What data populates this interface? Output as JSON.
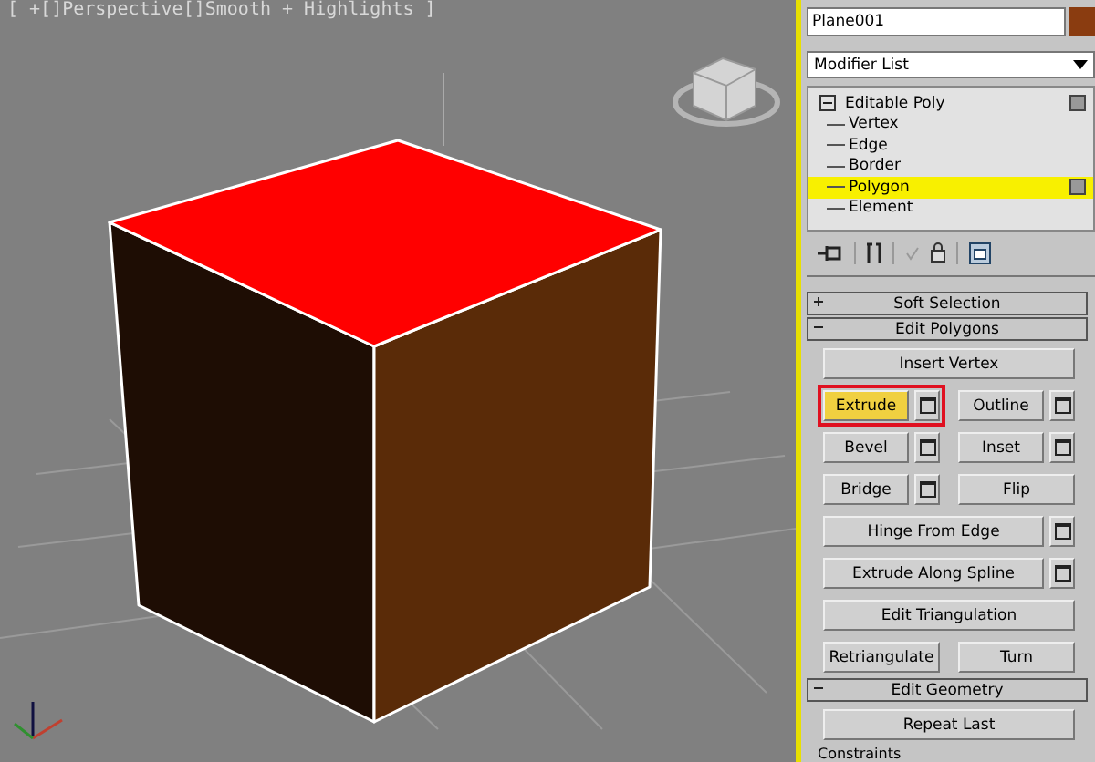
{
  "viewport": {
    "label": "[ +[]Perspective[]Smooth + Highlights ]"
  },
  "command_panel": {
    "object_name": "Plane001",
    "modifier_list": "Modifier List",
    "stack": [
      {
        "label": "Editable Poly",
        "expanded": true,
        "selected": false,
        "children": [
          {
            "label": "Vertex",
            "selected": false
          },
          {
            "label": "Edge",
            "selected": false
          },
          {
            "label": "Border",
            "selected": false
          },
          {
            "label": "Polygon",
            "selected": true
          },
          {
            "label": "Element",
            "selected": false
          }
        ]
      }
    ],
    "rollouts": [
      {
        "title": "Soft Selection",
        "expanded": false
      },
      {
        "title": "Edit Polygons",
        "expanded": true,
        "rows": [
          [
            {
              "label": "Insert Vertex",
              "settings": false,
              "selected": false,
              "annotated": false
            }
          ],
          [
            {
              "label": "Extrude",
              "settings": true,
              "selected": true,
              "annotated": true
            },
            {
              "label": "Outline",
              "settings": true,
              "selected": false,
              "annotated": false
            }
          ],
          [
            {
              "label": "Bevel",
              "settings": true,
              "selected": false,
              "annotated": false
            },
            {
              "label": "Inset",
              "settings": true,
              "selected": false,
              "annotated": false
            }
          ],
          [
            {
              "label": "Bridge",
              "settings": true,
              "selected": false,
              "annotated": false
            },
            {
              "label": "Flip",
              "settings": false,
              "selected": false,
              "annotated": false
            }
          ],
          [
            {
              "label": "Hinge From Edge",
              "settings": true,
              "selected": false,
              "annotated": false
            }
          ],
          [
            {
              "label": "Extrude Along Spline",
              "settings": true,
              "selected": false,
              "annotated": false
            }
          ],
          [
            {
              "label": "Edit Triangulation",
              "settings": false,
              "selected": false,
              "annotated": false
            }
          ],
          [
            {
              "label": "Retriangulate",
              "settings": false,
              "selected": false,
              "annotated": false
            },
            {
              "label": "Turn",
              "settings": false,
              "selected": false,
              "annotated": false
            }
          ]
        ]
      },
      {
        "title": "Edit Geometry",
        "expanded": true,
        "rows": [
          [
            {
              "label": "Repeat Last",
              "settings": false,
              "selected": false,
              "annotated": false
            }
          ]
        ]
      }
    ],
    "section_label": "Constraints"
  }
}
